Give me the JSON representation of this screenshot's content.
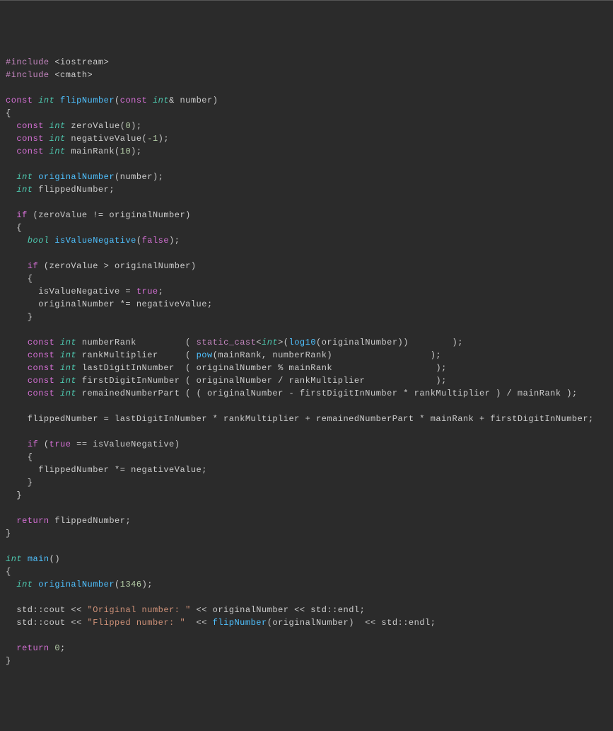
{
  "code": {
    "lines": [
      {
        "tokens": [
          {
            "t": "#include ",
            "c": "preproc"
          },
          {
            "t": "<iostream>",
            "c": "include-path"
          }
        ]
      },
      {
        "tokens": [
          {
            "t": "#include ",
            "c": "preproc"
          },
          {
            "t": "<cmath>",
            "c": "include-path"
          }
        ]
      },
      {
        "tokens": []
      },
      {
        "tokens": [
          {
            "t": "const ",
            "c": "const-kw"
          },
          {
            "t": "int",
            "c": "type"
          },
          {
            "t": " ",
            "c": "punct"
          },
          {
            "t": "flipNumber",
            "c": "func"
          },
          {
            "t": "(",
            "c": "punct"
          },
          {
            "t": "const ",
            "c": "const-kw"
          },
          {
            "t": "int",
            "c": "type"
          },
          {
            "t": "& number)",
            "c": "punct"
          }
        ]
      },
      {
        "tokens": [
          {
            "t": "{",
            "c": "punct"
          }
        ]
      },
      {
        "tokens": [
          {
            "t": "  ",
            "c": "punct"
          },
          {
            "t": "const ",
            "c": "const-kw"
          },
          {
            "t": "int",
            "c": "type"
          },
          {
            "t": " zeroValue(",
            "c": "punct"
          },
          {
            "t": "0",
            "c": "number"
          },
          {
            "t": ");",
            "c": "punct"
          }
        ]
      },
      {
        "tokens": [
          {
            "t": "  ",
            "c": "punct"
          },
          {
            "t": "const ",
            "c": "const-kw"
          },
          {
            "t": "int",
            "c": "type"
          },
          {
            "t": " negativeValue(",
            "c": "punct"
          },
          {
            "t": "-1",
            "c": "number"
          },
          {
            "t": ");",
            "c": "punct"
          }
        ]
      },
      {
        "tokens": [
          {
            "t": "  ",
            "c": "punct"
          },
          {
            "t": "const ",
            "c": "const-kw"
          },
          {
            "t": "int",
            "c": "type"
          },
          {
            "t": " mainRank(",
            "c": "punct"
          },
          {
            "t": "10",
            "c": "number"
          },
          {
            "t": ");",
            "c": "punct"
          }
        ]
      },
      {
        "tokens": []
      },
      {
        "tokens": [
          {
            "t": "  ",
            "c": "punct"
          },
          {
            "t": "int",
            "c": "type"
          },
          {
            "t": " ",
            "c": "punct"
          },
          {
            "t": "originalNumber",
            "c": "func"
          },
          {
            "t": "(number);",
            "c": "punct"
          }
        ]
      },
      {
        "tokens": [
          {
            "t": "  ",
            "c": "punct"
          },
          {
            "t": "int",
            "c": "type"
          },
          {
            "t": " flippedNumber;",
            "c": "punct"
          }
        ]
      },
      {
        "tokens": []
      },
      {
        "tokens": [
          {
            "t": "  ",
            "c": "punct"
          },
          {
            "t": "if",
            "c": "keyword"
          },
          {
            "t": " (zeroValue != originalNumber)",
            "c": "punct"
          }
        ]
      },
      {
        "tokens": [
          {
            "t": "  {",
            "c": "punct"
          }
        ]
      },
      {
        "tokens": [
          {
            "t": "    ",
            "c": "punct"
          },
          {
            "t": "bool",
            "c": "type"
          },
          {
            "t": " ",
            "c": "punct"
          },
          {
            "t": "isValueNegative",
            "c": "func"
          },
          {
            "t": "(",
            "c": "punct"
          },
          {
            "t": "false",
            "c": "boolean"
          },
          {
            "t": ");",
            "c": "punct"
          }
        ]
      },
      {
        "tokens": []
      },
      {
        "tokens": [
          {
            "t": "    ",
            "c": "punct"
          },
          {
            "t": "if",
            "c": "keyword"
          },
          {
            "t": " (zeroValue > originalNumber)",
            "c": "punct"
          }
        ]
      },
      {
        "tokens": [
          {
            "t": "    {",
            "c": "punct"
          }
        ]
      },
      {
        "tokens": [
          {
            "t": "      isValueNegative = ",
            "c": "punct"
          },
          {
            "t": "true",
            "c": "boolean"
          },
          {
            "t": ";",
            "c": "punct"
          }
        ]
      },
      {
        "tokens": [
          {
            "t": "      originalNumber *= negativeValue;",
            "c": "punct"
          }
        ]
      },
      {
        "tokens": [
          {
            "t": "    }",
            "c": "punct"
          }
        ]
      },
      {
        "tokens": []
      },
      {
        "tokens": [
          {
            "t": "    ",
            "c": "punct"
          },
          {
            "t": "const ",
            "c": "const-kw"
          },
          {
            "t": "int",
            "c": "type"
          },
          {
            "t": " numberRank         ( ",
            "c": "punct"
          },
          {
            "t": "static_cast",
            "c": "cast"
          },
          {
            "t": "<",
            "c": "punct"
          },
          {
            "t": "int",
            "c": "type"
          },
          {
            "t": ">(",
            "c": "punct"
          },
          {
            "t": "log10",
            "c": "func"
          },
          {
            "t": "(originalNumber))        );",
            "c": "punct"
          }
        ]
      },
      {
        "tokens": [
          {
            "t": "    ",
            "c": "punct"
          },
          {
            "t": "const ",
            "c": "const-kw"
          },
          {
            "t": "int",
            "c": "type"
          },
          {
            "t": " rankMultiplier     ( ",
            "c": "punct"
          },
          {
            "t": "pow",
            "c": "func"
          },
          {
            "t": "(mainRank, numberRank)                  );",
            "c": "punct"
          }
        ]
      },
      {
        "tokens": [
          {
            "t": "    ",
            "c": "punct"
          },
          {
            "t": "const ",
            "c": "const-kw"
          },
          {
            "t": "int",
            "c": "type"
          },
          {
            "t": " lastDigitInNumber  ( originalNumber % mainRank                   );",
            "c": "punct"
          }
        ]
      },
      {
        "tokens": [
          {
            "t": "    ",
            "c": "punct"
          },
          {
            "t": "const ",
            "c": "const-kw"
          },
          {
            "t": "int",
            "c": "type"
          },
          {
            "t": " firstDigitInNumber ( originalNumber / rankMultiplier             );",
            "c": "punct"
          }
        ]
      },
      {
        "tokens": [
          {
            "t": "    ",
            "c": "punct"
          },
          {
            "t": "const ",
            "c": "const-kw"
          },
          {
            "t": "int",
            "c": "type"
          },
          {
            "t": " remainedNumberPart ( ( originalNumber - firstDigitInNumber * rankMultiplier ) / mainRank );",
            "c": "punct"
          }
        ]
      },
      {
        "tokens": []
      },
      {
        "tokens": [
          {
            "t": "    flippedNumber = lastDigitInNumber * rankMultiplier + remainedNumberPart * mainRank + firstDigitInNumber;",
            "c": "punct"
          }
        ]
      },
      {
        "tokens": []
      },
      {
        "tokens": [
          {
            "t": "    ",
            "c": "punct"
          },
          {
            "t": "if",
            "c": "keyword"
          },
          {
            "t": " (",
            "c": "punct"
          },
          {
            "t": "true",
            "c": "boolean"
          },
          {
            "t": " == isValueNegative)",
            "c": "punct"
          }
        ]
      },
      {
        "tokens": [
          {
            "t": "    {",
            "c": "punct"
          }
        ]
      },
      {
        "tokens": [
          {
            "t": "      flippedNumber *= negativeValue;",
            "c": "punct"
          }
        ]
      },
      {
        "tokens": [
          {
            "t": "    }",
            "c": "punct"
          }
        ]
      },
      {
        "tokens": [
          {
            "t": "  }",
            "c": "punct"
          }
        ]
      },
      {
        "tokens": []
      },
      {
        "tokens": [
          {
            "t": "  ",
            "c": "punct"
          },
          {
            "t": "return",
            "c": "keyword"
          },
          {
            "t": " flippedNumber;",
            "c": "punct"
          }
        ]
      },
      {
        "tokens": [
          {
            "t": "}",
            "c": "punct"
          }
        ]
      },
      {
        "tokens": []
      },
      {
        "tokens": [
          {
            "t": "int",
            "c": "type"
          },
          {
            "t": " ",
            "c": "punct"
          },
          {
            "t": "main",
            "c": "func"
          },
          {
            "t": "()",
            "c": "punct"
          }
        ]
      },
      {
        "tokens": [
          {
            "t": "{",
            "c": "punct"
          }
        ]
      },
      {
        "tokens": [
          {
            "t": "  ",
            "c": "punct"
          },
          {
            "t": "int",
            "c": "type"
          },
          {
            "t": " ",
            "c": "punct"
          },
          {
            "t": "originalNumber",
            "c": "func"
          },
          {
            "t": "(",
            "c": "punct"
          },
          {
            "t": "1346",
            "c": "number"
          },
          {
            "t": ");",
            "c": "punct"
          }
        ]
      },
      {
        "tokens": []
      },
      {
        "tokens": [
          {
            "t": "  std::cout << ",
            "c": "punct"
          },
          {
            "t": "\"Original number: \"",
            "c": "string"
          },
          {
            "t": " << originalNumber << std::endl;",
            "c": "punct"
          }
        ]
      },
      {
        "tokens": [
          {
            "t": "  std::cout << ",
            "c": "punct"
          },
          {
            "t": "\"Flipped number: \"",
            "c": "string"
          },
          {
            "t": "  << ",
            "c": "punct"
          },
          {
            "t": "flipNumber",
            "c": "func"
          },
          {
            "t": "(originalNumber)  << std::endl;",
            "c": "punct"
          }
        ]
      },
      {
        "tokens": []
      },
      {
        "tokens": [
          {
            "t": "  ",
            "c": "punct"
          },
          {
            "t": "return ",
            "c": "keyword"
          },
          {
            "t": "0",
            "c": "number"
          },
          {
            "t": ";",
            "c": "punct"
          }
        ]
      },
      {
        "tokens": [
          {
            "t": "}",
            "c": "punct"
          }
        ]
      }
    ]
  }
}
